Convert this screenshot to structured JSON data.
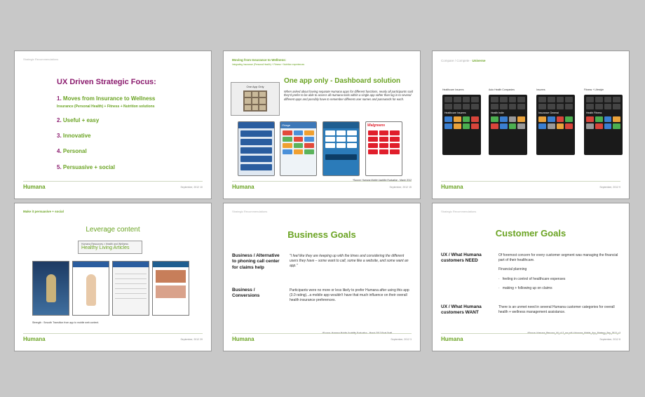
{
  "footer": {
    "logo": "Humana"
  },
  "slide1": {
    "crumb": "Strategic Recommendations",
    "title": "UX Driven Strategic Focus:",
    "items": [
      {
        "num": "1.",
        "label": "Moves from Insurance to Wellness"
      },
      {
        "num": "2.",
        "label": "Useful + easy"
      },
      {
        "num": "3.",
        "label": "Innovative"
      },
      {
        "num": "4.",
        "label": "Personal"
      },
      {
        "num": "5.",
        "label": "Persuasive + social"
      }
    ],
    "subline": "Insurance (Personal Health)  +  Fitness  +  Nutrition solutions",
    "footer_right": "September, 2012     10"
  },
  "slide2": {
    "header": "Moving from Insurance to Wellness:",
    "subheader": "Integrating Insurance (Personal Health)  +  Fitness  +  Nutrition experiences",
    "box_label": "One App Only",
    "title": "One app only - Dashboard solution",
    "paragraph": "When asked about having separate Humana apps for different functions, nearly all participants said they'd prefer to be able to access all Humana tools within a single  app rather than log in to several different apps and possibly have to remember different user names and passwords for each.",
    "phones": [
      {
        "label": "",
        "color": "#2a5d9f"
      },
      {
        "label": "iTriage",
        "color": "#3d78b8"
      },
      {
        "label": "",
        "color": "#2b7bb9"
      },
      {
        "label": "Walgreens",
        "color": "#ffffff"
      }
    ],
    "source": "*Source: Humana Mobile Usability Evaluation - March 2012",
    "footer_right": "September, 2012     15"
  },
  "slide3": {
    "title_a": "Compare / Compete -",
    "title_b": "Universe",
    "categories": [
      {
        "label": "Healthcare Insurers",
        "sub": "Healthcare Insurers"
      },
      {
        "label": "Auto Health Companies",
        "sub": "Health Indie"
      },
      {
        "label": "Insurers",
        "sub": "Insurance General"
      },
      {
        "label": "Fitness + Lifestyle",
        "sub": "Health Fitness"
      }
    ],
    "footer_right": "September, 2012     9"
  },
  "slide4": {
    "header": "Make it persuasive + social",
    "title": "Leverage content",
    "box_small": "Humana Resources  >  Health and Wellness",
    "box_big": "Healthy Living Articles",
    "caption": "Strength : Smooth Transition from app to mobile web content.",
    "footer_right": "September, 2012     29"
  },
  "slide5": {
    "crumb": "Strategic Recommendations",
    "title": "Business Goals",
    "left1": "Business / Alternative to phoning call center for claims help",
    "right1": "\"I feel like they are keeping up with the times and considering the different users they have – some want to call, some like a website, and some want an app.\"",
    "left2": "Business / Conversions",
    "right2": "Participants were no more or less likely to prefer Humana after using this app (3.0 rating)...a mobile app wouldn't have that much influence on their overall health insurance preferences.",
    "source": "*Source: Humana Mobile Usability Evaluation - March 2012 Final Draft",
    "footer_right": "September, 2012     3"
  },
  "slide6": {
    "crumb": "Strategic Recommendations",
    "title": "Customer Goals",
    "left1": "UX / What Humana customers NEED",
    "right1": "Of foremost concern for every customer segment was managing the financial part of their healthcare.",
    "right1b": "Financial planning",
    "bullet1": "feeling in control of healthcare expenses",
    "bullet2": "making + following up on claims",
    "left2": "UX / What Humana customers WANT",
    "right2": "There is an unmet need in several Humana customer categories for overall health + wellness management assistance.",
    "source": "*Source: Humana_Persona_All_v4.2_sm.pdf + Humana_Mobile_App_Strategy_Sep_2012_v2",
    "footer_right": "September, 2012     8"
  },
  "colors": {
    "green": "#6aa322",
    "purple": "#8b1b6e"
  }
}
